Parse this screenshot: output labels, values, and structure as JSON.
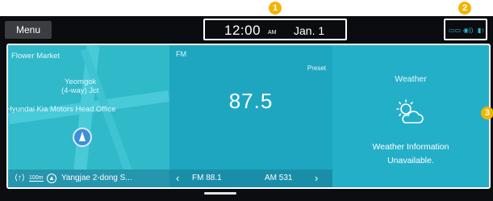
{
  "topbar": {
    "menu_label": "Menu",
    "time": "12:00",
    "ampm": "AM",
    "date": "Jan. 1"
  },
  "callouts": [
    "1",
    "2",
    "3"
  ],
  "map": {
    "labels": [
      "Flower Market",
      "Yeomgok",
      "(4-way) Jct",
      "Hyundai Kia Motors Head Office"
    ],
    "scale": "100m",
    "address": "Yangjae 2-dong S..."
  },
  "radio": {
    "band": "FM",
    "preset_label": "Preset",
    "frequency": "87.5",
    "prev_label": "FM 88.1",
    "next_label": "AM 531",
    "prev_icon": "chevron-left-icon",
    "next_icon": "chevron-right-icon"
  },
  "weather": {
    "title": "Weather",
    "icon": "partly-cloudy-icon",
    "message_line1": "Weather Information",
    "message_line2": "Unavailable."
  },
  "colors": {
    "accent": "#1ea6c0",
    "callout": "#f2b400",
    "map": "#2fb9c9"
  }
}
